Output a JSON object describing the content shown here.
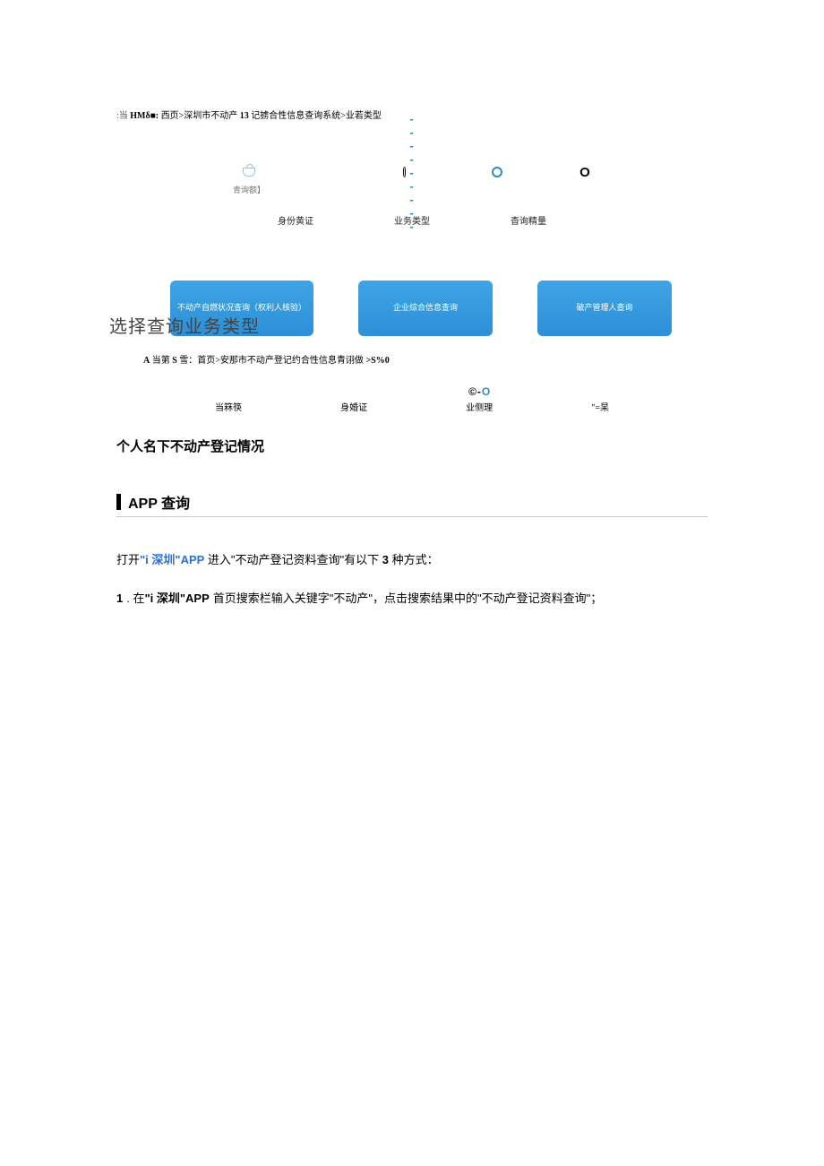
{
  "breadcrumb1": {
    "prefix": ":当",
    "bold1": "HMδ■:",
    "p1": "西页>深圳市不动产",
    "bold2": "13",
    "p2": "记掳合性信息查询系统>业若类型"
  },
  "stepper1": {
    "step1_sub": "青询额】",
    "label1": "身份黄证",
    "label2": "业务类型",
    "label3": "杳询精量"
  },
  "select_title": "选择查询业务类型",
  "cards": {
    "c1": "不动产自燃状况查询（权利人核验）",
    "c2": "企业综合信息查询",
    "c3": "破产管理人查询"
  },
  "breadcrumb2": {
    "prefix": "A",
    "mid": "当第",
    "bold1": "S",
    "p1": "雪：首页>安那市不动产登记约合性信息青诩做",
    "bold2": ">S%0"
  },
  "stepper2": {
    "l1": "当箖筷",
    "l2": "身婚证",
    "l3": "业侧理",
    "l4": "\"=杲"
  },
  "heading_personal": "个人名下不动产登记情况",
  "heading_app": "APP 查询",
  "para1": {
    "p1": "打开",
    "blue": "\"i 深圳\"APP",
    "p2": "进入\"不动产登记资料查询\"有以下",
    "bold3": "3",
    "p3": "种方式："
  },
  "item1": {
    "num": "1",
    "dot": ". 在",
    "bold": "\"i 深圳\"APP",
    "rest": "首页搜索栏输入关键字\"不动产\"，点击搜索结果中的\"不动产登记资料查询\"；"
  }
}
